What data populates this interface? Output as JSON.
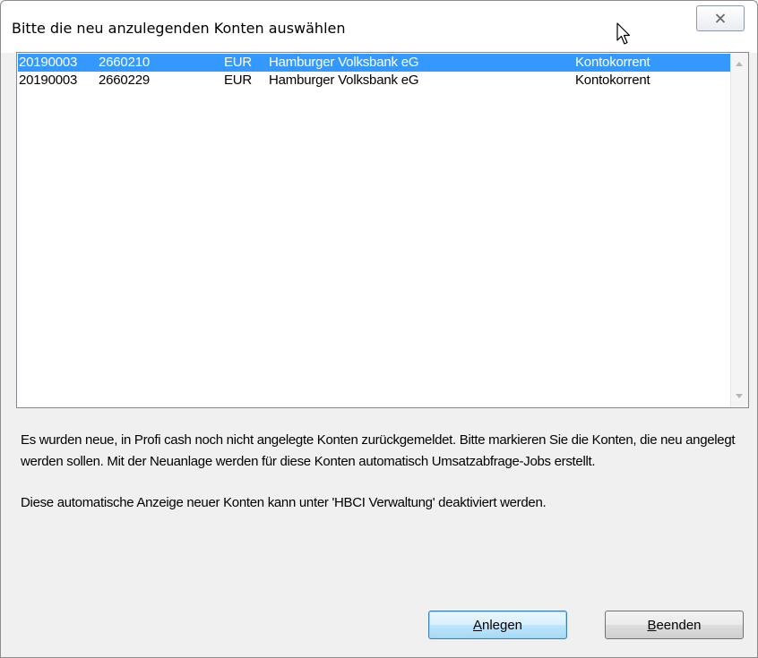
{
  "dialog": {
    "title": "Bitte die neu anzulegenden Konten auswählen"
  },
  "accounts": [
    {
      "blz": "20190003",
      "konto": "2660210",
      "currency": "EUR",
      "bank": "Hamburger Volksbank eG",
      "type": "Kontokorrent",
      "selected": true
    },
    {
      "blz": "20190003",
      "konto": "2660229",
      "currency": "EUR",
      "bank": "Hamburger Volksbank eG",
      "type": "Kontokorrent",
      "selected": false
    }
  ],
  "info": {
    "paragraph1": "Es wurden neue, in Profi cash noch nicht angelegte Konten zurückgemeldet. Bitte markieren Sie die Konten, die neu angelegt werden sollen. Mit der Neuanlage werden für diese Konten automatisch Umsatzabfrage-Jobs erstellt.",
    "paragraph2": "Diese automatische Anzeige neuer Konten kann unter 'HBCI Verwaltung' deaktiviert werden."
  },
  "buttons": {
    "anlegen": {
      "mnemonic": "A",
      "rest": "nlegen"
    },
    "beenden": {
      "mnemonic": "B",
      "rest": "eenden"
    }
  },
  "colors": {
    "selection": "#3399ff",
    "dialog_background": "#f0f0f0"
  },
  "icons": {
    "close": "close-icon",
    "cursor": "mouse-cursor-icon"
  }
}
